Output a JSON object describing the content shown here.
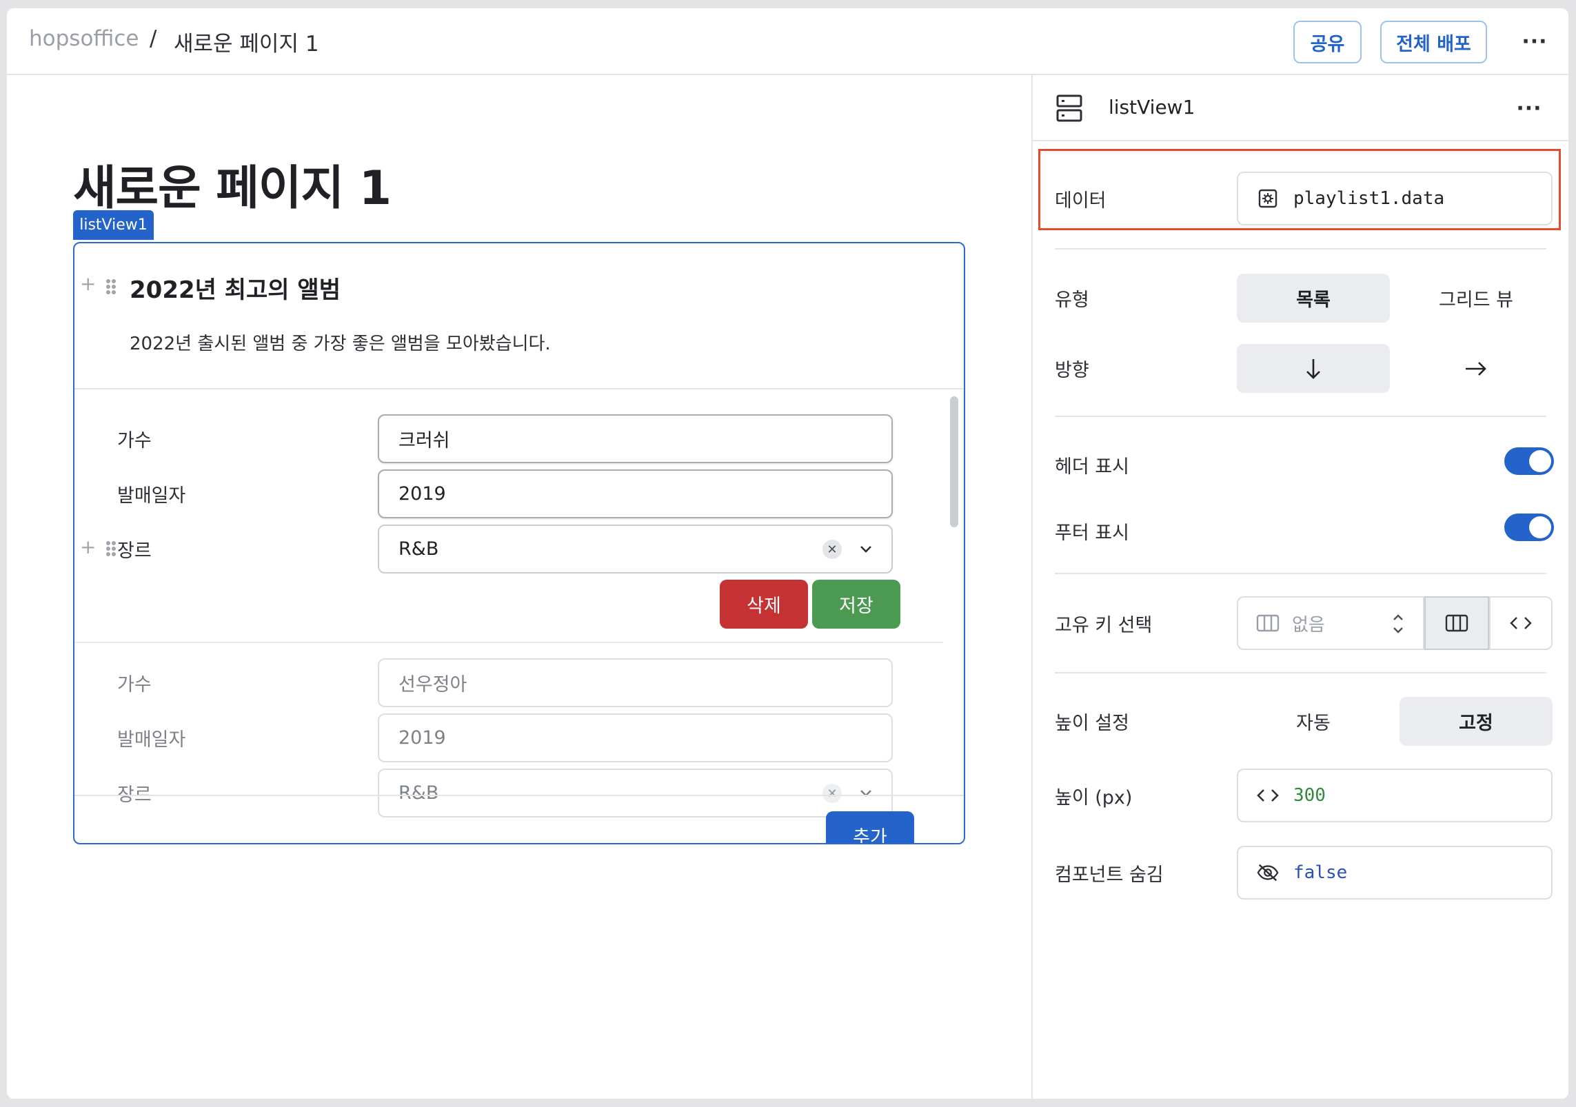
{
  "topbar": {
    "workspace": "hopsoffice",
    "separator": "/",
    "page": "새로운 페이지 1",
    "share_label": "공유",
    "deploy_label": "전체 배포",
    "more": "···"
  },
  "canvas": {
    "page_title": "새로운 페이지 1",
    "component_tag": "listView1",
    "listview": {
      "title": "2022년 최고의 앨범",
      "description": "2022년 출시된 앨범 중 가장 좋은 앨범을 모아봤습니다.",
      "items": [
        {
          "artist_label": "가수",
          "artist_value": "크러쉬",
          "date_label": "발매일자",
          "date_value": "2019",
          "genre_label": "장르",
          "genre_value": "R&B",
          "delete_label": "삭제",
          "save_label": "저장"
        },
        {
          "artist_label": "가수",
          "artist_value": "선우정아",
          "date_label": "발매일자",
          "date_value": "2019",
          "genre_label": "장르",
          "genre_value": "R&B"
        }
      ],
      "add_label": "추가"
    }
  },
  "panel": {
    "component_name": "listView1",
    "more": "···",
    "data_label": "데이터",
    "data_value": "playlist1.data",
    "type_label": "유형",
    "type_options": [
      "목록",
      "그리드 뷰"
    ],
    "type_selected": "목록",
    "direction_label": "방향",
    "direction_options": [
      "↓",
      "→"
    ],
    "direction_selected": "↓",
    "header_label": "헤더 표시",
    "header_on": true,
    "footer_label": "푸터 표시",
    "footer_on": true,
    "key_label": "고유 키 선택",
    "key_value": "없음",
    "height_mode_label": "높이 설정",
    "height_mode_options": [
      "자동",
      "고정"
    ],
    "height_mode_selected": "고정",
    "height_label": "높이 (px)",
    "height_value": "300",
    "hidden_label": "컴포넌트 숨김",
    "hidden_value": "false"
  },
  "colors": {
    "accent": "#2463c9",
    "delete": "#c43234",
    "save": "#4c9a52",
    "highlight": "#e54c2e"
  },
  "icons": [
    "listview-icon",
    "settings-box-icon",
    "columns-icon",
    "code-icon",
    "eye-off-icon",
    "chevron-down-icon",
    "clear-icon",
    "sort-updown-icon",
    "drag-handle-icon",
    "plus-icon"
  ]
}
